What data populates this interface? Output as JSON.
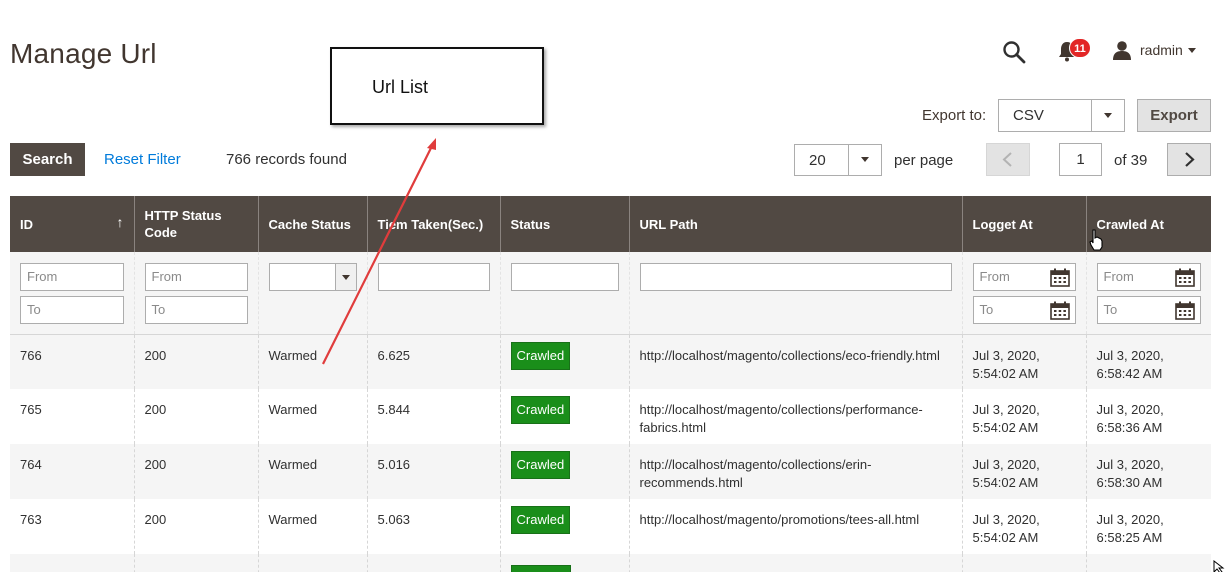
{
  "page": {
    "title": "Manage Url"
  },
  "header": {
    "notifications_count": "11",
    "user_name": "radmin"
  },
  "callout": {
    "text": "Url List"
  },
  "export": {
    "label": "Export to:",
    "format": "CSV",
    "button_label": "Export"
  },
  "toolbar": {
    "search_label": "Search",
    "reset_label": "Reset Filter",
    "records_found": "766 records found",
    "per_page_value": "20",
    "per_page_label": "per page",
    "current_page": "1",
    "total_pages": "of 39"
  },
  "grid": {
    "columns": [
      {
        "label": "ID"
      },
      {
        "label": "HTTP Status Code"
      },
      {
        "label": "Cache Status"
      },
      {
        "label": "Tiem Taken(Sec.)"
      },
      {
        "label": "Status"
      },
      {
        "label": "URL Path"
      },
      {
        "label": "Logget At"
      },
      {
        "label": "Crawled At"
      }
    ],
    "filters": {
      "from_placeholder": "From",
      "to_placeholder": "To"
    },
    "rows": [
      {
        "id": "766",
        "http": "200",
        "cache": "Warmed",
        "time": "6.625",
        "status": "Crawled",
        "url": "http://localhost/magento/collections/eco-friendly.html",
        "logged": "Jul 3, 2020, 5:54:02 AM",
        "crawled": "Jul 3, 2020, 6:58:42 AM"
      },
      {
        "id": "765",
        "http": "200",
        "cache": "Warmed",
        "time": "5.844",
        "status": "Crawled",
        "url": "http://localhost/magento/collections/performance-fabrics.html",
        "logged": "Jul 3, 2020, 5:54:02 AM",
        "crawled": "Jul 3, 2020, 6:58:36 AM"
      },
      {
        "id": "764",
        "http": "200",
        "cache": "Warmed",
        "time": "5.016",
        "status": "Crawled",
        "url": "http://localhost/magento/collections/erin-recommends.html",
        "logged": "Jul 3, 2020, 5:54:02 AM",
        "crawled": "Jul 3, 2020, 6:58:30 AM"
      },
      {
        "id": "763",
        "http": "200",
        "cache": "Warmed",
        "time": "5.063",
        "status": "Crawled",
        "url": "http://localhost/magento/promotions/tees-all.html",
        "logged": "Jul 3, 2020, 5:54:02 AM",
        "crawled": "Jul 3, 2020, 6:58:25 AM"
      }
    ]
  },
  "colors": {
    "header_bg": "#514943",
    "crawled_green": "#1a8e1a",
    "link_blue": "#007bdb",
    "badge_red": "#e22626",
    "annotation_arrow": "#e03c3c"
  },
  "icons": [
    "search-icon",
    "bell-icon",
    "user-icon",
    "calendar-icon",
    "chevron-left-icon",
    "chevron-right-icon",
    "sort-arrow-icon"
  ]
}
